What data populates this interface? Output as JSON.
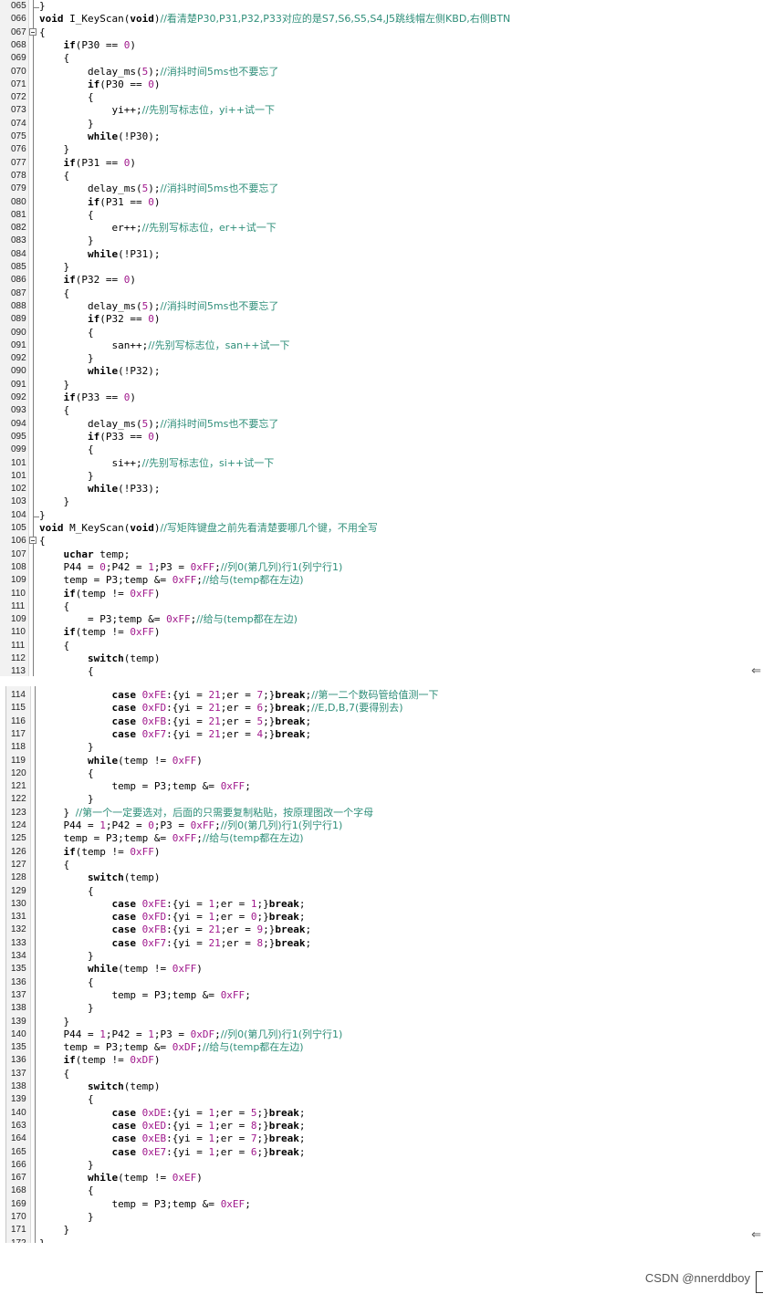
{
  "panels": [
    {
      "lines": [
        {
          "n": "065",
          "t": "}"
        },
        {
          "n": "066",
          "t": "void I_KeyScan(void)//看清楚P30,P31,P32,P33对应的是S7,S6,S5,S4,J5跳线帽左侧KBD,右侧BTN"
        },
        {
          "n": "067",
          "t": "{"
        },
        {
          "n": "068",
          "t": "    if(P30 == 0)"
        },
        {
          "n": "069",
          "t": "    {"
        },
        {
          "n": "070",
          "t": "        delay_ms(5);//消抖时间5ms也不要忘了"
        },
        {
          "n": "071",
          "t": "        if(P30 == 0)"
        },
        {
          "n": "072",
          "t": "        {"
        },
        {
          "n": "073",
          "t": "            yi++;//先别写标志位，yi++试一下"
        },
        {
          "n": "074",
          "t": "        }"
        },
        {
          "n": "075",
          "t": "        while(!P30);"
        },
        {
          "n": "076",
          "t": "    }"
        },
        {
          "n": "077",
          "t": "    if(P31 == 0)"
        },
        {
          "n": "078",
          "t": "    {"
        },
        {
          "n": "079",
          "t": "        delay_ms(5);//消抖时间5ms也不要忘了"
        },
        {
          "n": "080",
          "t": "        if(P31 == 0)"
        },
        {
          "n": "081",
          "t": "        {"
        },
        {
          "n": "082",
          "t": "            er++;//先别写标志位，er++试一下"
        },
        {
          "n": "083",
          "t": "        }"
        },
        {
          "n": "084",
          "t": "        while(!P31);"
        },
        {
          "n": "085",
          "t": "    }"
        },
        {
          "n": "086",
          "t": "    if(P32 == 0)"
        },
        {
          "n": "087",
          "t": "    {"
        },
        {
          "n": "088",
          "t": "        delay_ms(5);//消抖时间5ms也不要忘了"
        },
        {
          "n": "089",
          "t": "        if(P32 == 0)"
        },
        {
          "n": "090",
          "t": "        {"
        },
        {
          "n": "091",
          "t": "            san++;//先别写标志位，san++试一下"
        },
        {
          "n": "092",
          "t": "        }"
        },
        {
          "n": "090",
          "t": "        while(!P32);"
        },
        {
          "n": "091",
          "t": "    }"
        },
        {
          "n": "092",
          "t": "    if(P33 == 0)"
        },
        {
          "n": "093",
          "t": "    {"
        },
        {
          "n": "094",
          "t": "        delay_ms(5);//消抖时间5ms也不要忘了"
        },
        {
          "n": "095",
          "t": "        if(P33 == 0)"
        },
        {
          "n": "099",
          "t": "        {"
        },
        {
          "n": "101",
          "t": "            si++;//先别写标志位，si++试一下"
        },
        {
          "n": "101",
          "t": "        }"
        },
        {
          "n": "102",
          "t": "        while(!P33);"
        },
        {
          "n": "103",
          "t": "    }"
        },
        {
          "n": "104",
          "t": "}"
        },
        {
          "n": "105",
          "t": "void M_KeyScan(void)//写矩阵键盘之前先看清楚要哪几个键，不用全写"
        },
        {
          "n": "106",
          "t": "{"
        },
        {
          "n": "107",
          "t": "    uchar temp;"
        },
        {
          "n": "108",
          "t": "    P44 = 0;P42 = 1;P3 = 0xFF;//列0(第几列)行1(列宁行1)"
        },
        {
          "n": "109",
          "t": "    temp = P3;temp &= 0xFF;//给与(temp都在左边)"
        },
        {
          "n": "110",
          "t": "    if(temp != 0xFF)"
        },
        {
          "n": "111",
          "t": "    {"
        },
        {
          "n": "109",
          "t": "        = P3;temp &= 0xFF;//给与(temp都在左边)"
        },
        {
          "n": "110",
          "t": "    if(temp != 0xFF)"
        },
        {
          "n": "111",
          "t": "    {"
        },
        {
          "n": "112",
          "t": "        switch(temp)"
        },
        {
          "n": "113",
          "t": "        {"
        }
      ]
    },
    {
      "lines": [
        {
          "n": "114",
          "t": "            case 0xFE:{yi = 21;er = 7;}break;//第一二个数码管给值测一下"
        },
        {
          "n": "115",
          "t": "            case 0xFD:{yi = 21;er = 6;}break;//E,D,B,7(要得别去)"
        },
        {
          "n": "116",
          "t": "            case 0xFB:{yi = 21;er = 5;}break;"
        },
        {
          "n": "117",
          "t": "            case 0xF7:{yi = 21;er = 4;}break;"
        },
        {
          "n": "118",
          "t": "        }"
        },
        {
          "n": "119",
          "t": "        while(temp != 0xFF)"
        },
        {
          "n": "120",
          "t": "        {"
        },
        {
          "n": "121",
          "t": "            temp = P3;temp &= 0xFF;"
        },
        {
          "n": "122",
          "t": "        }"
        },
        {
          "n": "123",
          "t": "    } //第一个一定要选对，后面的只需要复制粘贴，按原理图改一个字母"
        },
        {
          "n": "124",
          "t": "    P44 = 1;P42 = 0;P3 = 0xFF;//列0(第几列)行1(列宁行1)"
        },
        {
          "n": "125",
          "t": "    temp = P3;temp &= 0xFF;//给与(temp都在左边)"
        },
        {
          "n": "126",
          "t": "    if(temp != 0xFF)"
        },
        {
          "n": "127",
          "t": "    {"
        },
        {
          "n": "128",
          "t": "        switch(temp)"
        },
        {
          "n": "129",
          "t": "        {"
        },
        {
          "n": "130",
          "t": "            case 0xFE:{yi = 1;er = 1;}break;"
        },
        {
          "n": "131",
          "t": "            case 0xFD:{yi = 1;er = 0;}break;"
        },
        {
          "n": "132",
          "t": "            case 0xFB:{yi = 21;er = 9;}break;"
        },
        {
          "n": "133",
          "t": "            case 0xF7:{yi = 21;er = 8;}break;"
        },
        {
          "n": "134",
          "t": "        }"
        },
        {
          "n": "135",
          "t": "        while(temp != 0xFF)"
        },
        {
          "n": "136",
          "t": "        {"
        },
        {
          "n": "137",
          "t": "            temp = P3;temp &= 0xFF;"
        },
        {
          "n": "138",
          "t": "        }"
        },
        {
          "n": "139",
          "t": "    }"
        },
        {
          "n": "140",
          "t": "    P44 = 1;P42 = 1;P3 = 0xDF;//列0(第几列)行1(列宁行1)"
        },
        {
          "n": "135",
          "t": "    temp = P3;temp &= 0xDF;//给与(temp都在左边)"
        },
        {
          "n": "136",
          "t": "    if(temp != 0xDF)"
        },
        {
          "n": "137",
          "t": "    {"
        },
        {
          "n": "138",
          "t": "        switch(temp)"
        },
        {
          "n": "139",
          "t": "        {"
        },
        {
          "n": "140",
          "t": "            case 0xDE:{yi = 1;er = 5;}break;"
        },
        {
          "n": "163",
          "t": "            case 0xED:{yi = 1;er = 8;}break;"
        },
        {
          "n": "164",
          "t": "            case 0xEB:{yi = 1;er = 7;}break;"
        },
        {
          "n": "165",
          "t": "            case 0xE7:{yi = 1;er = 6;}break;"
        },
        {
          "n": "166",
          "t": "        }"
        },
        {
          "n": "167",
          "t": "        while(temp != 0xEF)"
        },
        {
          "n": "168",
          "t": "        {"
        },
        {
          "n": "169",
          "t": "            temp = P3;temp &= 0xEF;"
        },
        {
          "n": "170",
          "t": "        }"
        },
        {
          "n": "171",
          "t": "    }"
        },
        {
          "n": "172",
          "t": "}"
        }
      ]
    }
  ],
  "scroll_arrow_icon": "left-arrow-icon",
  "scroll_arrow_glyph": "⇐",
  "watermark": "CSDN @nnerddboy"
}
